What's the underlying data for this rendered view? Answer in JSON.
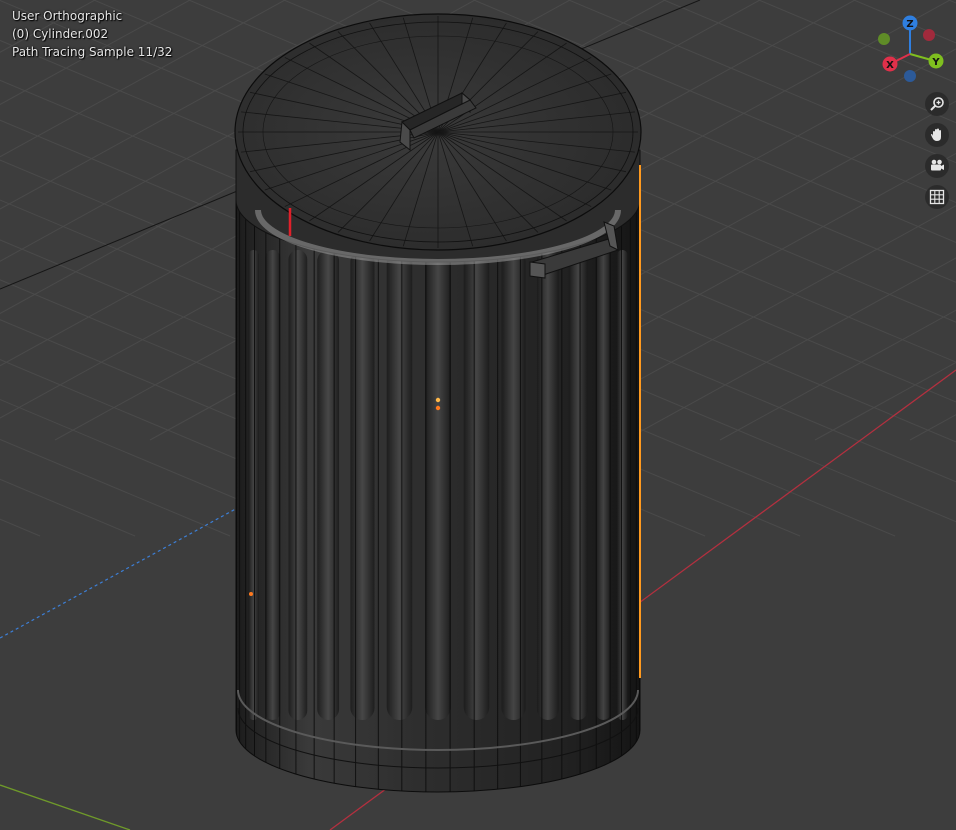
{
  "viewport": {
    "view_name": "User Orthographic",
    "active_object": "(0) Cylinder.002",
    "render_status": "Path Tracing Sample 11/32"
  },
  "gizmo": {
    "axes": [
      {
        "label": "Z",
        "color": "#2f7fe0"
      },
      {
        "label": "Y",
        "color": "#7fbf1f"
      },
      {
        "label": "X",
        "color": "#e0304a"
      }
    ]
  },
  "nav_buttons": [
    {
      "icon": "zoom-icon"
    },
    {
      "icon": "hand-pan-icon"
    },
    {
      "icon": "camera-icon"
    },
    {
      "icon": "grid-icon"
    }
  ],
  "colors": {
    "background": "#3d3d3d",
    "grid": "#4a4a4a",
    "x_axis": "#b3303f",
    "y_axis": "#6f9a2a",
    "selection": "#ff9a1f"
  }
}
